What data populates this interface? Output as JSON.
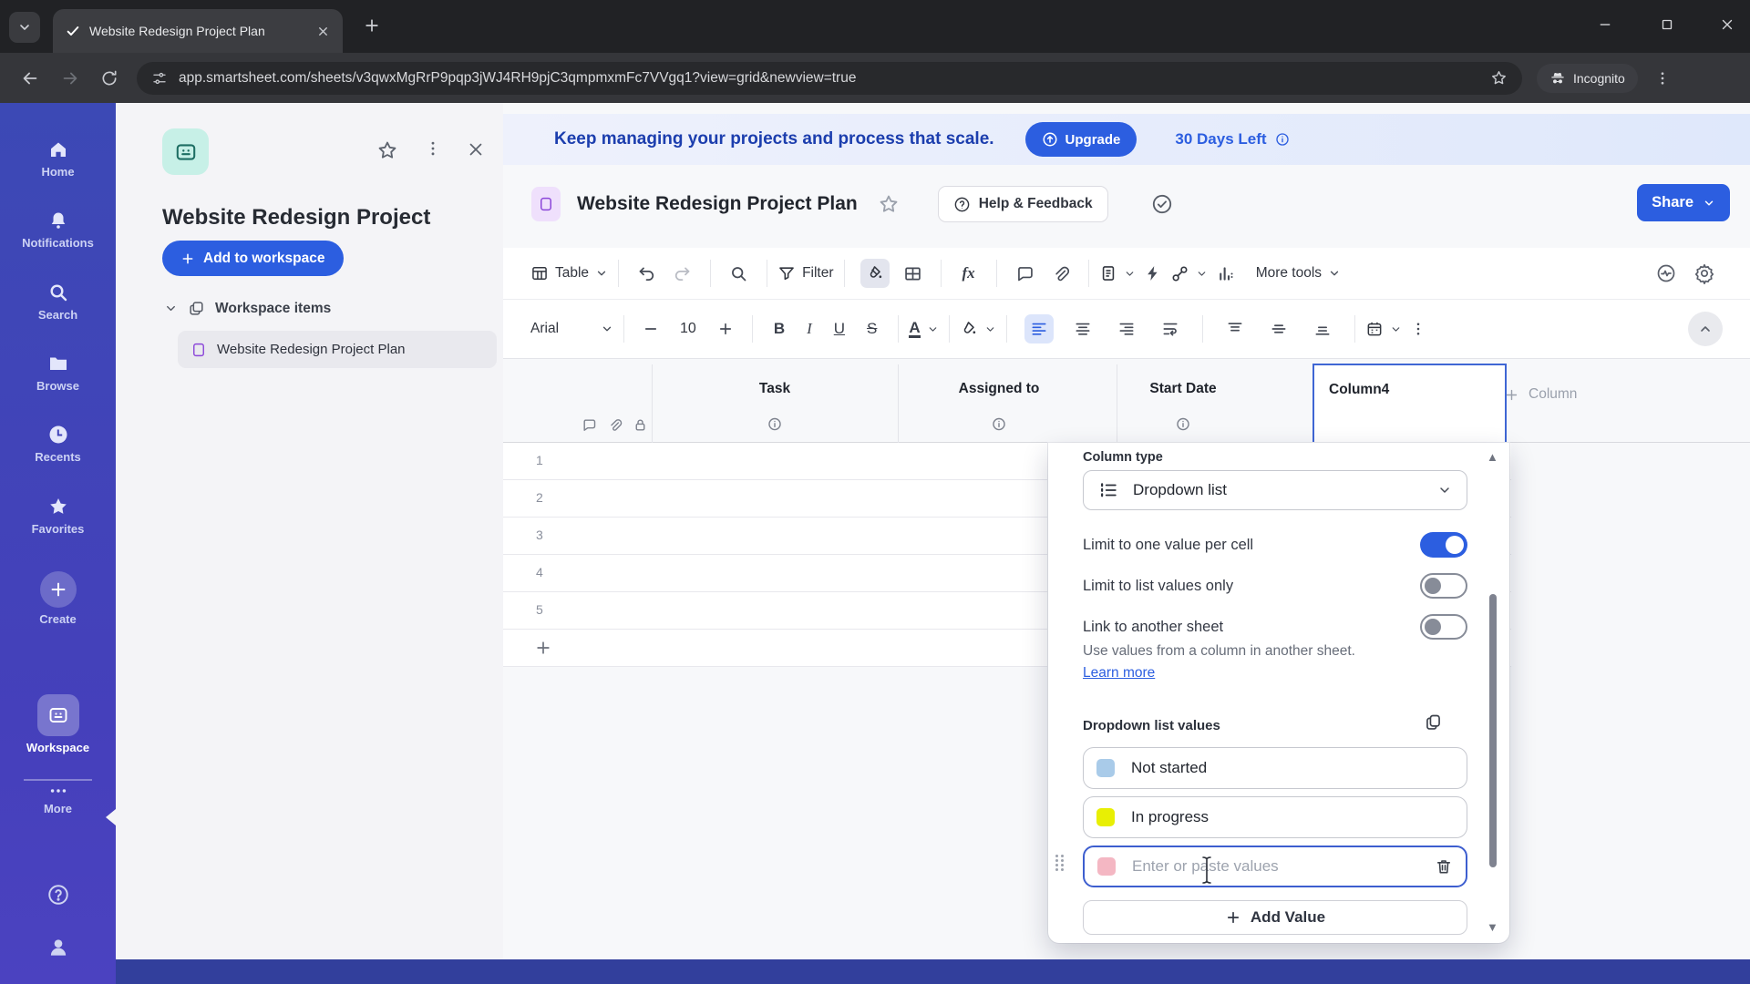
{
  "colors": {
    "accent": "#2c5ee0",
    "banner_text": "#1c3eae",
    "selected_column_border": "#3f66d4"
  },
  "browser": {
    "tab_title": "Website Redesign Project Plan",
    "url": "app.smartsheet.com/sheets/v3qwxMgRrP9pqp3jWJ4RH9pjC3qmpmxmFc7VVgq1?view=grid&newview=true",
    "incognito_label": "Incognito"
  },
  "nav_rail": {
    "items": [
      "Home",
      "Notifications",
      "Search",
      "Browse",
      "Recents",
      "Favorites",
      "Create",
      "Workspace",
      "More"
    ]
  },
  "workspace_panel": {
    "title": "Website Redesign Project",
    "add_to_workspace_label": "Add to workspace",
    "section_label": "Workspace items",
    "item_label": "Website Redesign Project Plan"
  },
  "banner": {
    "message": "Keep managing your projects and process that scale.",
    "upgrade_label": "Upgrade",
    "trial_label": "30 Days Left"
  },
  "sheet": {
    "title": "Website Redesign Project Plan",
    "help_label": "Help & Feedback",
    "share_label": "Share"
  },
  "toolbar": {
    "view_label": "Table",
    "filter_label": "Filter",
    "more_tools_label": "More tools",
    "font_name": "Arial",
    "font_size": "10",
    "bold_glyph": "B",
    "italic_glyph": "I",
    "underline_glyph": "U",
    "strikethrough_glyph": "S",
    "text_color_glyph": "A",
    "formula_glyph": "fx"
  },
  "grid": {
    "columns": [
      "Task",
      "Assigned to",
      "Start Date",
      "Column4"
    ],
    "add_column_label": "Column",
    "row_numbers": [
      "1",
      "2",
      "3",
      "4",
      "5"
    ]
  },
  "column_panel": {
    "column_type_label": "Column type",
    "column_type_value": "Dropdown list",
    "toggles": [
      {
        "label": "Limit to one value per cell",
        "on": true
      },
      {
        "label": "Limit to list values only",
        "on": false
      },
      {
        "label": "Link to another sheet",
        "on": false
      }
    ],
    "link_help_text": "Use values from a column in another sheet.",
    "learn_more_label": "Learn more",
    "values_label": "Dropdown list values",
    "values": [
      {
        "label": "Not started",
        "color": "#a9cbe9"
      },
      {
        "label": "In progress",
        "color": "#e8ef04"
      }
    ],
    "new_value_placeholder": "Enter or paste values",
    "new_value_color": "#f4b7c3",
    "add_value_label": "Add Value"
  }
}
